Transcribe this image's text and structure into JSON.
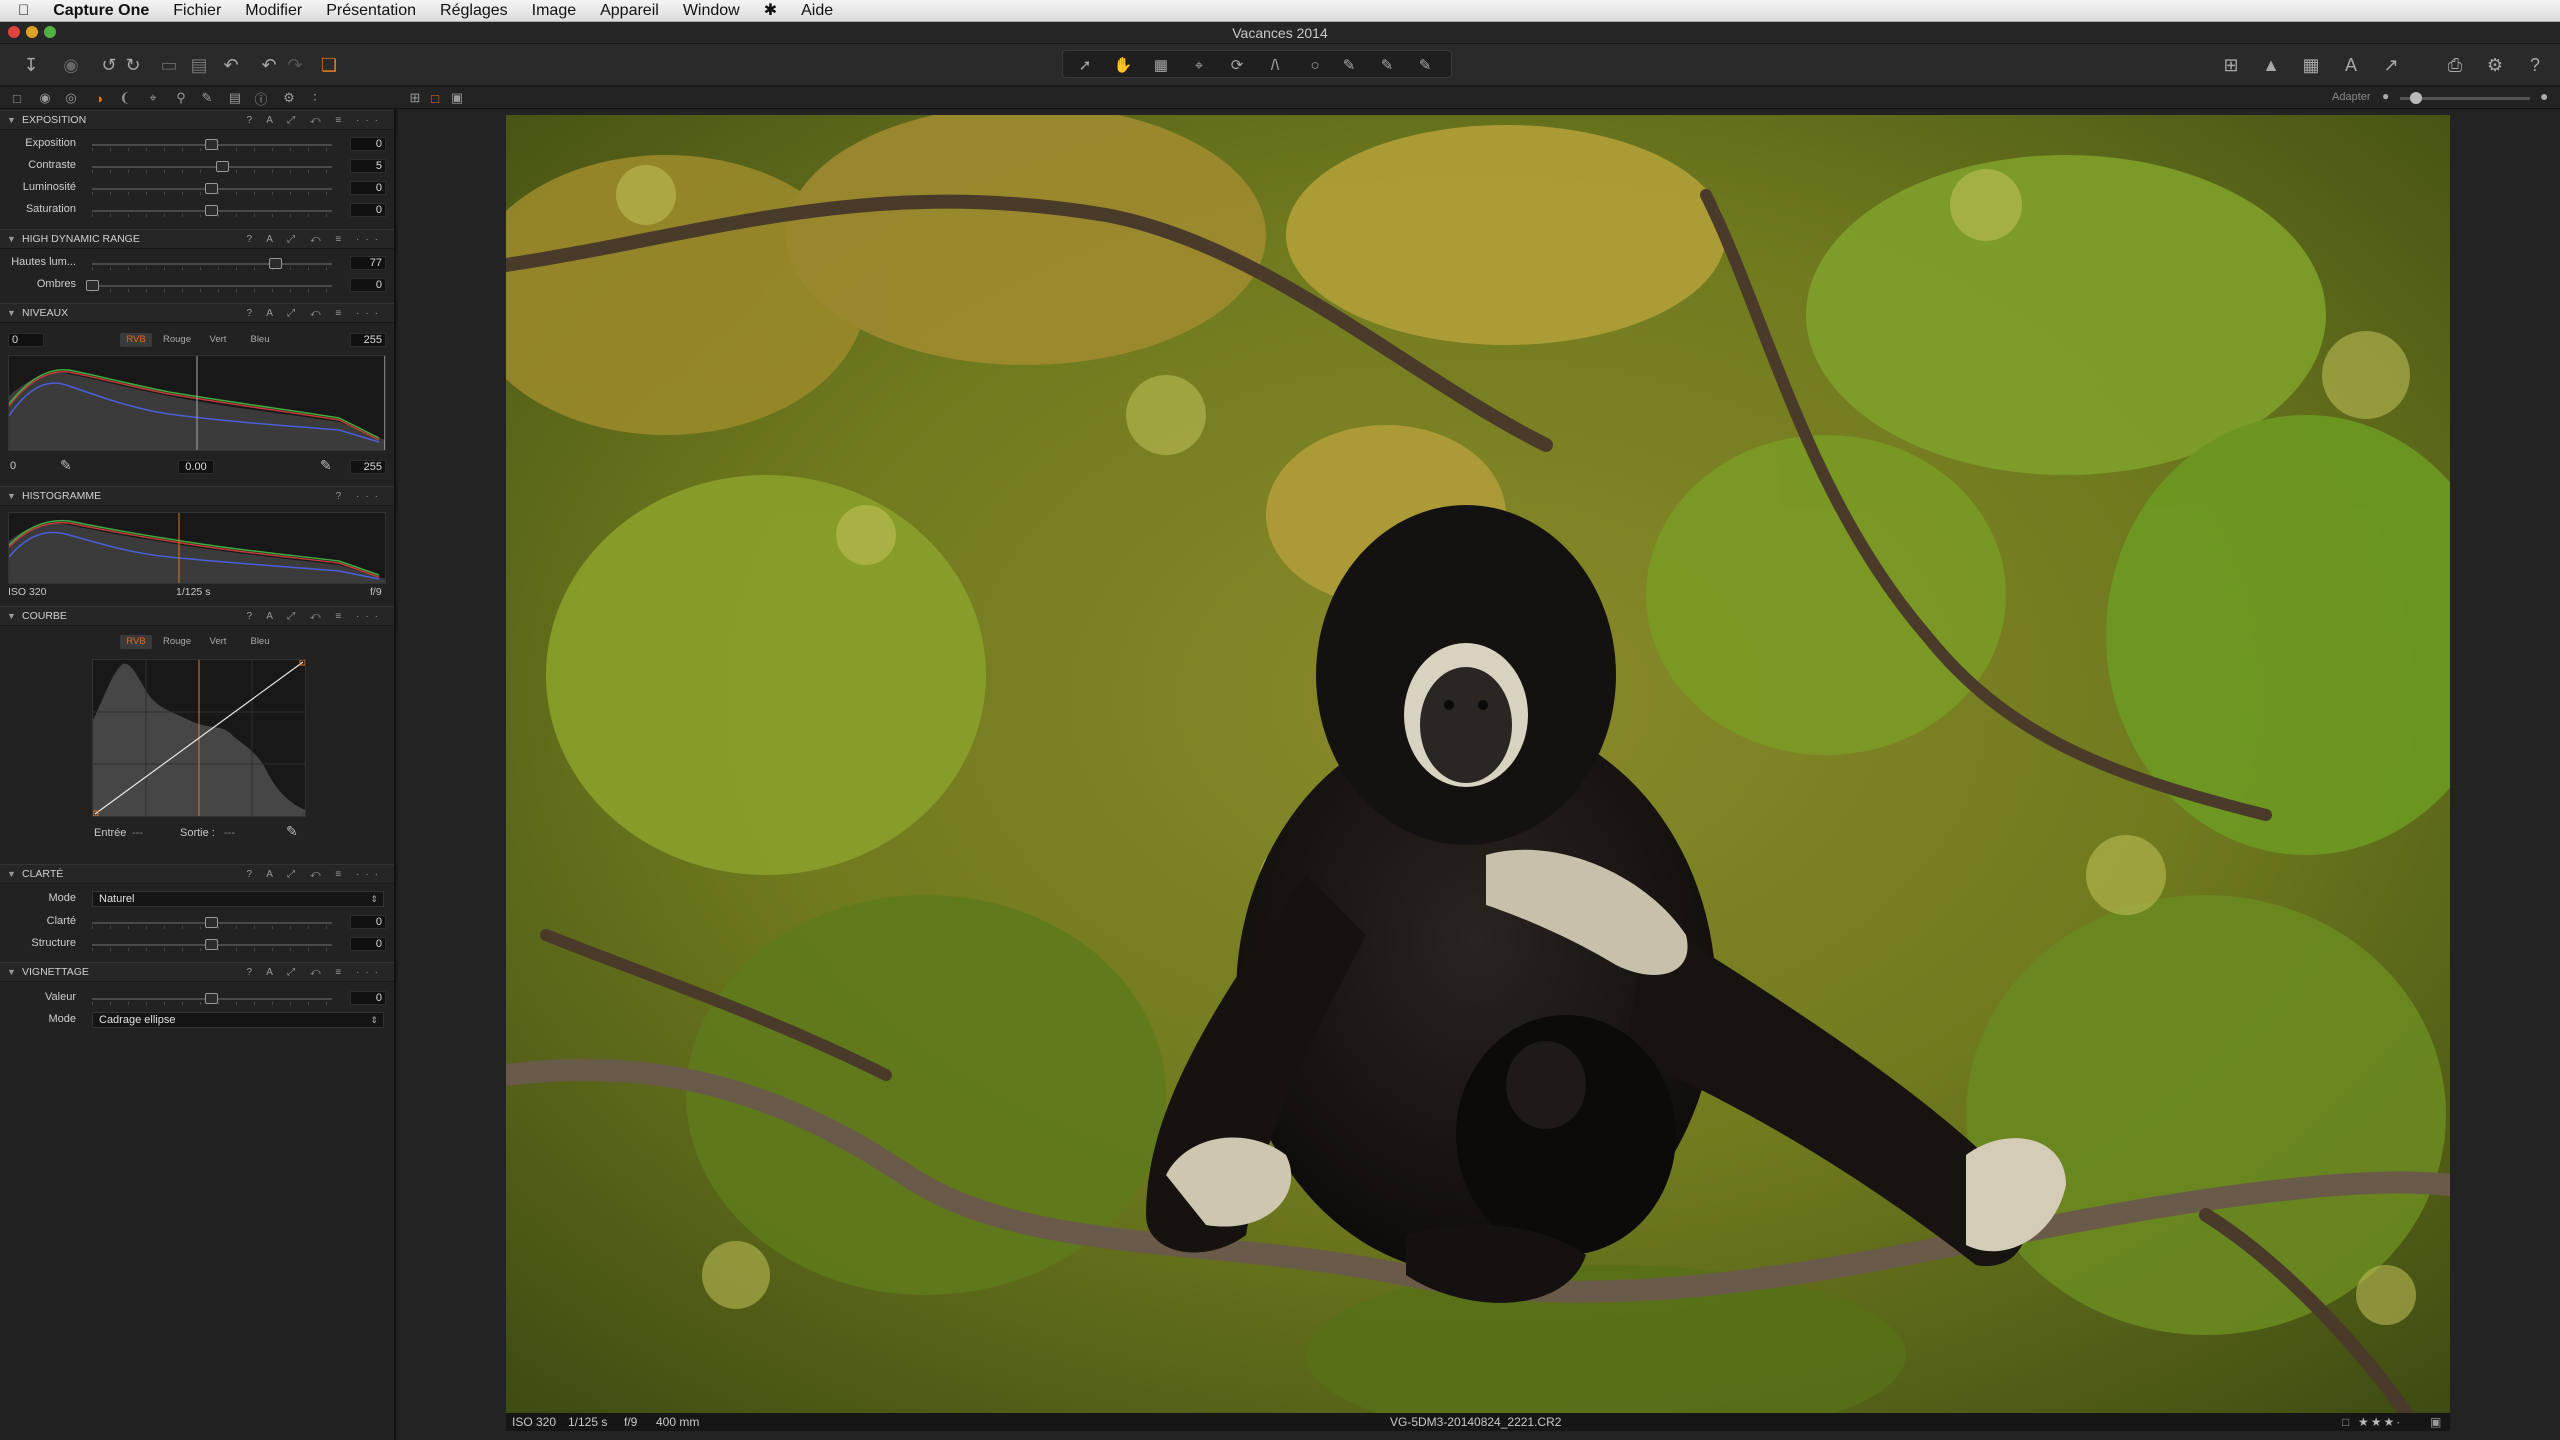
{
  "menubar": {
    "app_name": "Capture One",
    "items": [
      "Fichier",
      "Modifier",
      "Présentation",
      "Réglages",
      "Image",
      "Appareil",
      "Window",
      "Aide"
    ]
  },
  "window": {
    "title": "Vacances 2014"
  },
  "toolbar": {
    "left_icons": [
      "import-icon",
      "camera-icon",
      "rotate-left-icon",
      "rotate-right-icon",
      "move-icon",
      "trash-icon",
      "undo-icon",
      "undo-alt-icon",
      "redo-icon",
      "copy-apply-icon"
    ],
    "cursor_tools": [
      "select-icon",
      "pan-icon",
      "loupe-icon",
      "crop-icon",
      "rotate-icon",
      "keystone-icon",
      "circle-mask-icon",
      "brush-icon",
      "gradient-icon",
      "eraser-icon"
    ],
    "right_icons": [
      "layout-icon",
      "exposure-warning-icon",
      "grid-icon",
      "text-icon",
      "export-icon",
      "print-icon",
      "settings-icon",
      "help-icon"
    ]
  },
  "tabs": {
    "icons": [
      "library-icon",
      "capture-icon",
      "color-icon",
      "exposure-icon",
      "lens-icon",
      "crop-icon",
      "focus-icon",
      "details-icon",
      "metadata-icon",
      "info-icon",
      "output-icon",
      "batch-icon"
    ],
    "adapter_label": "Adapter"
  },
  "exposition": {
    "title": "EXPOSITION",
    "rows": [
      {
        "label": "Exposition",
        "value": "0"
      },
      {
        "label": "Contraste",
        "value": "5"
      },
      {
        "label": "Luminosité",
        "value": "0"
      },
      {
        "label": "Saturation",
        "value": "0"
      }
    ]
  },
  "hdr": {
    "title": "HIGH DYNAMIC RANGE",
    "rows": [
      {
        "label": "Hautes lum...",
        "value": "77"
      },
      {
        "label": "Ombres",
        "value": "0"
      }
    ]
  },
  "niveaux": {
    "title": "NIVEAUX",
    "in_low": "0",
    "in_high": "255",
    "channels": [
      "RVB",
      "Rouge",
      "Vert",
      "Bleu"
    ],
    "out_low": "0",
    "mid": "0.00",
    "out_high": "255"
  },
  "histogramme": {
    "title": "HISTOGRAMME",
    "iso": "ISO 320",
    "shutter": "1/125 s",
    "aperture": "f/9"
  },
  "courbe": {
    "title": "COURBE",
    "channels": [
      "RVB",
      "Rouge",
      "Vert",
      "Bleu"
    ],
    "entree_label": "Entrée",
    "entree_val": "---",
    "sortie_label": "Sortie :",
    "sortie_val": "---"
  },
  "clarte": {
    "title": "CLARTÉ",
    "mode_label": "Mode",
    "mode_value": "Naturel",
    "rows": [
      {
        "label": "Clarté",
        "value": "0"
      },
      {
        "label": "Structure",
        "value": "0"
      }
    ]
  },
  "vignettage": {
    "title": "VIGNETTAGE",
    "valeur_label": "Valeur",
    "valeur_value": "0",
    "mode_label": "Mode",
    "mode_value": "Cadrage ellipse"
  },
  "infostrip": {
    "iso": "ISO 320",
    "shutter": "1/125 s",
    "aperture": "f/9",
    "focal": "400 mm",
    "filename": "VG-5DM3-20140824_2221.CR2",
    "rating": "★★★·"
  }
}
